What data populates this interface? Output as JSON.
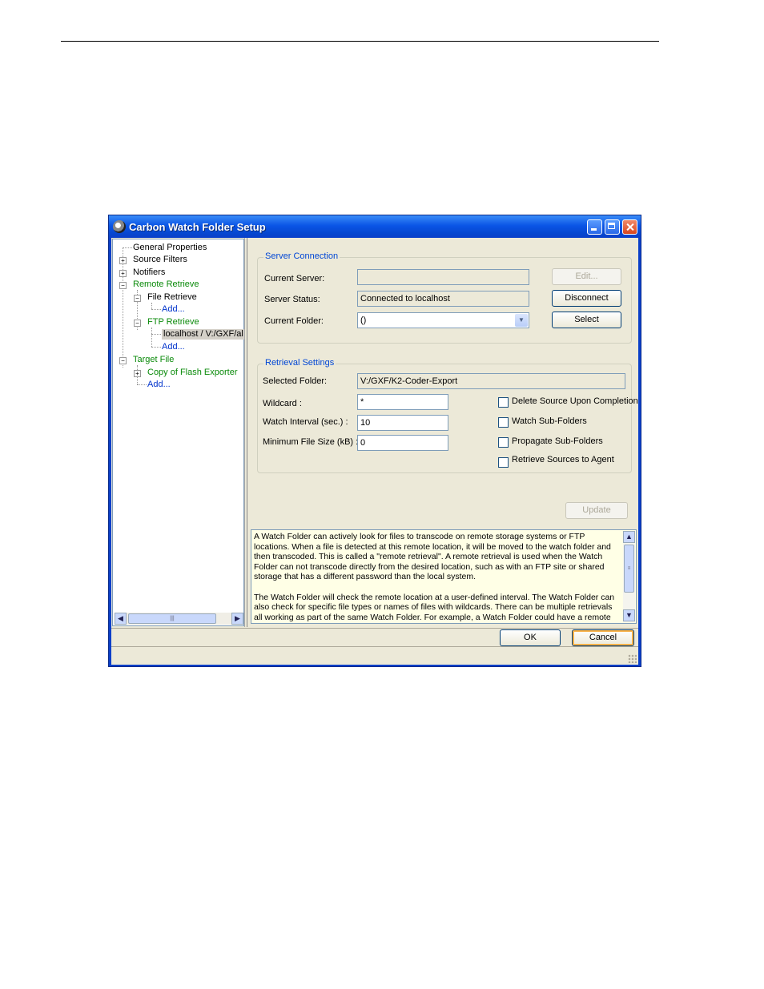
{
  "window": {
    "title": "Carbon Watch Folder Setup"
  },
  "tree": {
    "general_properties": "General Properties",
    "source_filters": "Source Filters",
    "notifiers": "Notifiers",
    "remote_retrieve": "Remote Retrieve",
    "file_retrieve": "File Retrieve",
    "file_retrieve_add": "Add...",
    "ftp_retrieve": "FTP Retrieve",
    "ftp_item": "localhost / V:/GXF/al",
    "ftp_add": "Add...",
    "target_file": "Target File",
    "copy_flash": "Copy of Flash Exporter",
    "target_add": "Add..."
  },
  "server": {
    "group_title": "Server Connection",
    "current_server_label": "Current Server:",
    "current_server_value": "",
    "server_status_label": "Server Status:",
    "server_status_value": "Connected to localhost",
    "current_folder_label": "Current Folder:",
    "current_folder_value": "()",
    "edit_button": "Edit...",
    "disconnect_button": "Disconnect",
    "select_button": "Select"
  },
  "retrieval": {
    "group_title": "Retrieval Settings",
    "selected_folder_label": "Selected Folder:",
    "selected_folder_value": "V:/GXF/K2-Coder-Export",
    "wildcard_label": "Wildcard :",
    "wildcard_value": "*",
    "interval_label": "Watch Interval (sec.) :",
    "interval_value": "10",
    "min_size_label": "Minimum File Size (kB) :",
    "min_size_value": "0",
    "delete_source": "Delete Source Upon Completion",
    "watch_sub": "Watch Sub-Folders",
    "propagate_sub": "Propagate Sub-Folders",
    "retrieve_agent": "Retrieve Sources to Agent"
  },
  "update_button": "Update",
  "info_text": "A Watch Folder can actively look for files to transcode on remote storage systems or FTP locations. When a file is detected at this remote location, it will be moved to the watch folder and then transcoded. This is called a \"remote retrieval\". A remote retrieval is used when the Watch Folder can not transcode directly from the desired location, such as with an FTP site or shared storage that has a different password than the local system.\n\nThe Watch Folder will check the remote location at a user-defined interval. The Watch Folder can also check for specific file types or names of files with wildcards. There can be multiple retrievals all working as part of the same Watch Folder. For example, a Watch Folder could have a remote",
  "footer": {
    "ok_button": "OK",
    "cancel_button": "Cancel"
  }
}
